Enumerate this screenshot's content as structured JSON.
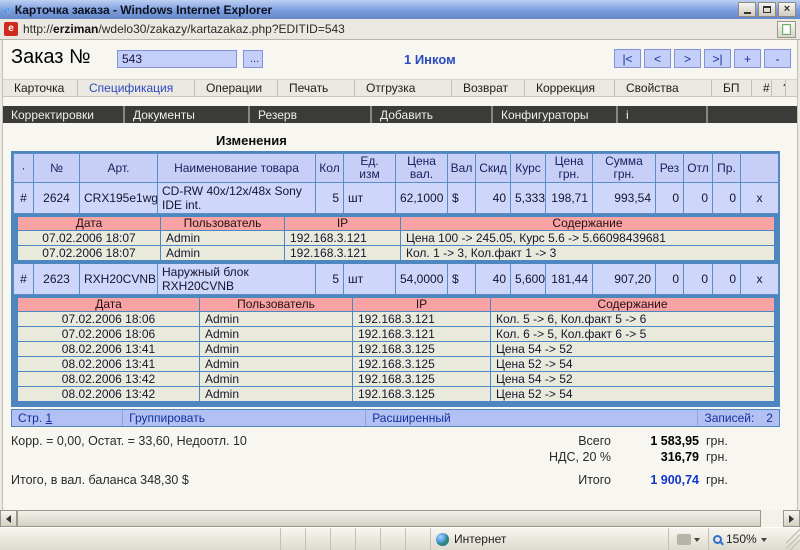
{
  "window": {
    "title": "Карточка заказа - Windows Internet Explorer",
    "url_prefix": "http://",
    "url_host": "erziman",
    "url_path": "/wdelo30/zakazy/kartazakaz.php?EDITID=543"
  },
  "order_bar": {
    "label": "Заказ №",
    "number": "543",
    "browse": "...",
    "client": "1 Инком",
    "nav": [
      "|<",
      "<",
      ">",
      ">|",
      "+",
      "-"
    ]
  },
  "tabs": [
    {
      "label": "Карточка",
      "active": false
    },
    {
      "label": "Спецификация",
      "active": true
    },
    {
      "label": "Операции",
      "active": false
    },
    {
      "label": "Печать",
      "active": false
    },
    {
      "label": "Отгрузка",
      "active": false
    },
    {
      "label": "Возврат",
      "active": false
    },
    {
      "label": "Коррекция",
      "active": false
    },
    {
      "label": "Свойства",
      "active": false
    },
    {
      "label": "БП",
      "active": false
    },
    {
      "label": "#",
      "active": false
    },
    {
      "label": "?",
      "active": false
    }
  ],
  "menu": [
    "Корректировки",
    "Документы",
    "Резерв",
    "Добавить",
    "Конфигураторы",
    "i"
  ],
  "section_title": "Изменения",
  "spec_table": {
    "headers": [
      "·",
      "№",
      "Арт.",
      "Наименование товара",
      "Кол",
      "Ед.\nизм",
      "Цена\nвал.",
      "Вал",
      "Скид",
      "Курс",
      "Цена\nгрн.",
      "Сумма\nгрн.",
      "Рез",
      "Отл",
      "Пр.",
      ""
    ],
    "history_headers": [
      "Дата",
      "Пользователь",
      "IP",
      "Содержание"
    ],
    "items": [
      {
        "cells": [
          "#",
          "2624",
          "CRX195e1wg",
          "CD-RW 40x/12x/48x Sony IDE int.",
          "5",
          "шт",
          "62,1000",
          "$",
          "40",
          "5,333",
          "198,71",
          "993,54",
          "0",
          "0",
          "0",
          "x"
        ],
        "history": [
          [
            "07.02.2006 18:07",
            "Admin",
            "192.168.3.121",
            "Цена 100 -> 245.05, Курс 5.6 -> 5.66098439681"
          ],
          [
            "07.02.2006 18:07",
            "Admin",
            "192.168.3.121",
            "Кол. 1 -> 3, Кол.факт 1 -> 3"
          ]
        ]
      },
      {
        "cells": [
          "#",
          "2623",
          "RXH20CVNB",
          "Наружный блок RXH20CVNB",
          "5",
          "шт",
          "54,0000",
          "$",
          "40",
          "5,600",
          "181,44",
          "907,20",
          "0",
          "0",
          "0",
          "x"
        ],
        "history": [
          [
            "07.02.2006 18:06",
            "Admin",
            "192.168.3.121",
            "Кол. 5 -> 6, Кол.факт 5 -> 6"
          ],
          [
            "07.02.2006 18:06",
            "Admin",
            "192.168.3.121",
            "Кол. 6 -> 5, Кол.факт 6 -> 5"
          ],
          [
            "08.02.2006 13:41",
            "Admin",
            "192.168.3.125",
            "Цена 54 -> 52"
          ],
          [
            "08.02.2006 13:41",
            "Admin",
            "192.168.3.125",
            "Цена 52 -> 54"
          ],
          [
            "08.02.2006 13:42",
            "Admin",
            "192.168.3.125",
            "Цена 54 -> 52"
          ],
          [
            "08.02.2006 13:42",
            "Admin",
            "192.168.3.125",
            "Цена 52 -> 54"
          ]
        ]
      }
    ]
  },
  "pager": {
    "page_label": "Стр.",
    "page": "1",
    "group": "Группировать",
    "extended": "Расширенный",
    "records_label": "Записей:",
    "records": "2"
  },
  "totals": {
    "correction_line": "Корр. = 0,00, Остат. = 33,60, Недоотл. 10",
    "balance_line": "Итого, в вал. баланса 348,30 $",
    "rows": [
      {
        "label": "Всего",
        "value": "1 583,95",
        "unit": "грн."
      },
      {
        "label": "НДС, 20 %",
        "value": "316,79",
        "unit": "грн."
      },
      {
        "label": "Итого",
        "value": "1 900,74",
        "unit": "грн."
      }
    ]
  },
  "statusbar": {
    "zone": "Интернет",
    "zoom": "150%"
  },
  "colors": {
    "frame_blue": "#4e86c0",
    "row_periwinkle": "#ced6fa",
    "header_periwinkle": "#c7cff7",
    "history_pink": "#f8a3a3",
    "history_row": "#e9e9dc",
    "link_blue": "#2b4bc0",
    "grand_total_blue": "#1336cc"
  }
}
